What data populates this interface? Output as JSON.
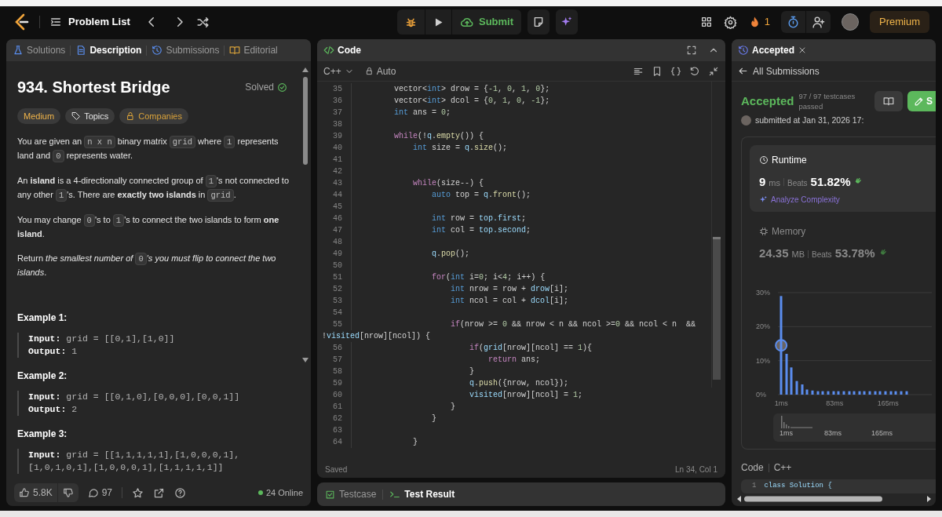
{
  "top_bar": {
    "problem_list": "Problem List",
    "submit": "Submit",
    "streak": "1",
    "premium": "Premium"
  },
  "description_panel": {
    "tabs": [
      {
        "label": "Solutions",
        "selected": false
      },
      {
        "label": "Description",
        "selected": true
      },
      {
        "label": "Submissions",
        "selected": false
      },
      {
        "label": "Editorial",
        "selected": false
      }
    ],
    "title": "934. Shortest Bridge",
    "status": "Solved",
    "tags": [
      {
        "label": "Medium",
        "kind": "difficulty"
      },
      {
        "label": "Topics",
        "kind": "topics"
      },
      {
        "label": "Companies",
        "kind": "locked"
      }
    ],
    "paragraphs": [
      [
        {
          "text": "You are given an "
        },
        {
          "code": "n x n"
        },
        {
          "text": " binary matrix "
        },
        {
          "code": "grid"
        },
        {
          "text": " where "
        },
        {
          "code": "1"
        },
        {
          "text": " represents land and "
        },
        {
          "code": "0"
        },
        {
          "text": " represents water."
        }
      ],
      [
        {
          "text": "An **island** is a 4-directionally connected group of "
        },
        {
          "code": "1"
        },
        {
          "text": "'s not connected to any other "
        },
        {
          "code": "1"
        },
        {
          "text": "'s. There are **exactly two islands** in "
        },
        {
          "code": "grid"
        },
        {
          "text": "."
        }
      ],
      [
        {
          "text": "You may change "
        },
        {
          "code": "0"
        },
        {
          "text": "'s to "
        },
        {
          "code": "1"
        },
        {
          "text": "'s to connect the two islands to form **one island**."
        }
      ],
      [
        {
          "text": "Return *the smallest number of* "
        },
        {
          "code": "0"
        },
        {
          "text": "*'s you must flip to connect the two islands*."
        }
      ]
    ],
    "examples": [
      {
        "title": "Example 1:",
        "input_label": "Input:",
        "input": "grid = [[0,1],[1,0]]",
        "output_label": "Output:",
        "output": "1"
      },
      {
        "title": "Example 2:",
        "input_label": "Input:",
        "input": "grid = [[0,1,0],[0,0,0],[0,0,1]]",
        "output_label": "Output:",
        "output": "2"
      },
      {
        "title": "Example 3:",
        "input_label": "Input:",
        "input": "grid = [[1,1,1,1,1],[1,0,0,0,1],[1,0,1,0,1],[1,0,0,0,1],[1,1,1,1,1]]"
      }
    ],
    "footer": {
      "likes": "5.8K",
      "comments": "97",
      "online": "24 Online"
    }
  },
  "code_panel": {
    "title": "Code",
    "language": "C++",
    "mode": "Auto",
    "lines": [
      {
        "number": "35",
        "tokens": [
          {
            "text": "        vector<",
            "kind": "plain"
          },
          {
            "text": "int",
            "kind": "type"
          },
          {
            "text": "> drow = {",
            "kind": "plain"
          },
          {
            "text": "-1",
            "kind": "number"
          },
          {
            "text": ", ",
            "kind": "plain"
          },
          {
            "text": "0",
            "kind": "number"
          },
          {
            "text": ", ",
            "kind": "plain"
          },
          {
            "text": "1",
            "kind": "number"
          },
          {
            "text": ", ",
            "kind": "plain"
          },
          {
            "text": "0",
            "kind": "number"
          },
          {
            "text": "};",
            "kind": "plain"
          }
        ]
      },
      {
        "number": "36",
        "tokens": [
          {
            "text": "        vector<",
            "kind": "plain"
          },
          {
            "text": "int",
            "kind": "type"
          },
          {
            "text": "> dcol = {",
            "kind": "plain"
          },
          {
            "text": "0",
            "kind": "number"
          },
          {
            "text": ", ",
            "kind": "plain"
          },
          {
            "text": "1",
            "kind": "number"
          },
          {
            "text": ", ",
            "kind": "plain"
          },
          {
            "text": "0",
            "kind": "number"
          },
          {
            "text": ", ",
            "kind": "plain"
          },
          {
            "text": "-1",
            "kind": "number"
          },
          {
            "text": "};",
            "kind": "plain"
          }
        ]
      },
      {
        "number": "37",
        "tokens": [
          {
            "text": "        int",
            "kind": "type"
          },
          {
            "text": " ans = ",
            "kind": "plain"
          },
          {
            "text": "0",
            "kind": "number"
          },
          {
            "text": ";",
            "kind": "plain"
          }
        ]
      },
      {
        "number": "38"
      },
      {
        "number": "39",
        "tokens": [
          {
            "text": "        while",
            "kind": "keyword"
          },
          {
            "text": "(!",
            "kind": "plain"
          },
          {
            "text": "q",
            "kind": "variable"
          },
          {
            "text": ".",
            "kind": "plain"
          },
          {
            "text": "empty",
            "kind": "function"
          },
          {
            "text": "()) {",
            "kind": "plain"
          }
        ]
      },
      {
        "number": "40",
        "tokens": [
          {
            "text": "            int",
            "kind": "type"
          },
          {
            "text": " size = ",
            "kind": "plain"
          },
          {
            "text": "q",
            "kind": "variable"
          },
          {
            "text": ".",
            "kind": "plain"
          },
          {
            "text": "size",
            "kind": "function"
          },
          {
            "text": "();",
            "kind": "plain"
          }
        ]
      },
      {
        "number": "41"
      },
      {
        "number": "42"
      },
      {
        "number": "43",
        "tokens": [
          {
            "text": "            while",
            "kind": "keyword"
          },
          {
            "text": "(size--) {",
            "kind": "plain"
          }
        ]
      },
      {
        "number": "44",
        "tokens": [
          {
            "text": "                auto",
            "kind": "type"
          },
          {
            "text": " top = ",
            "kind": "plain"
          },
          {
            "text": "q",
            "kind": "variable"
          },
          {
            "text": ".",
            "kind": "plain"
          },
          {
            "text": "front",
            "kind": "function"
          },
          {
            "text": "();",
            "kind": "plain"
          }
        ]
      },
      {
        "number": "45"
      },
      {
        "number": "46",
        "tokens": [
          {
            "text": "                int",
            "kind": "type"
          },
          {
            "text": " row = ",
            "kind": "plain"
          },
          {
            "text": "top.first",
            "kind": "variable"
          },
          {
            "text": ";",
            "kind": "plain"
          }
        ]
      },
      {
        "number": "47",
        "tokens": [
          {
            "text": "                int",
            "kind": "type"
          },
          {
            "text": " col = ",
            "kind": "plain"
          },
          {
            "text": "top.second",
            "kind": "variable"
          },
          {
            "text": ";",
            "kind": "plain"
          }
        ]
      },
      {
        "number": "48"
      },
      {
        "number": "49",
        "tokens": [
          {
            "text": "                q",
            "kind": "variable"
          },
          {
            "text": ".",
            "kind": "plain"
          },
          {
            "text": "pop",
            "kind": "function"
          },
          {
            "text": "();",
            "kind": "plain"
          }
        ]
      },
      {
        "number": "50"
      },
      {
        "number": "51",
        "tokens": [
          {
            "text": "                for",
            "kind": "keyword"
          },
          {
            "text": "(",
            "kind": "plain"
          },
          {
            "text": "int",
            "kind": "type"
          },
          {
            "text": " i=",
            "kind": "plain"
          },
          {
            "text": "0",
            "kind": "number"
          },
          {
            "text": "; i<",
            "kind": "plain"
          },
          {
            "text": "4",
            "kind": "number"
          },
          {
            "text": "; i++) {",
            "kind": "plain"
          }
        ]
      },
      {
        "number": "52",
        "tokens": [
          {
            "text": "                    int",
            "kind": "type"
          },
          {
            "text": " nrow = row + ",
            "kind": "plain"
          },
          {
            "text": "drow",
            "kind": "variable"
          },
          {
            "text": "[i];",
            "kind": "plain"
          }
        ]
      },
      {
        "number": "53",
        "tokens": [
          {
            "text": "                    int",
            "kind": "type"
          },
          {
            "text": " ncol = col + ",
            "kind": "plain"
          },
          {
            "text": "dcol",
            "kind": "variable"
          },
          {
            "text": "[i];",
            "kind": "plain"
          }
        ]
      },
      {
        "number": "54"
      },
      {
        "number": "55",
        "tokens": [
          {
            "text": "                    if",
            "kind": "keyword"
          },
          {
            "text": "(nrow >= ",
            "kind": "plain"
          },
          {
            "text": "0",
            "kind": "number"
          },
          {
            "text": " && nrow < n && ncol >=",
            "kind": "plain"
          },
          {
            "text": "0",
            "kind": "number"
          },
          {
            "text": " && ncol < n  &&",
            "kind": "plain"
          }
        ]
      },
      {
        "tokens": [
          {
            "text": "!",
            "kind": "plain"
          },
          {
            "text": "visited",
            "kind": "variable"
          },
          {
            "text": "[nrow][ncol]) {",
            "kind": "plain"
          }
        ]
      },
      {
        "number": "56",
        "tokens": [
          {
            "text": "                        if",
            "kind": "keyword"
          },
          {
            "text": "(",
            "kind": "plain"
          },
          {
            "text": "grid",
            "kind": "variable"
          },
          {
            "text": "[nrow][ncol] == ",
            "kind": "plain"
          },
          {
            "text": "1",
            "kind": "number"
          },
          {
            "text": "){",
            "kind": "plain"
          }
        ]
      },
      {
        "number": "57",
        "tokens": [
          {
            "text": "                            return",
            "kind": "keyword"
          },
          {
            "text": " ans;",
            "kind": "plain"
          }
        ]
      },
      {
        "number": "58",
        "tokens": [
          {
            "text": "                        }",
            "kind": "plain"
          }
        ]
      },
      {
        "number": "59",
        "tokens": [
          {
            "text": "                        q",
            "kind": "variable"
          },
          {
            "text": ".",
            "kind": "plain"
          },
          {
            "text": "push",
            "kind": "function"
          },
          {
            "text": "({nrow, ncol});",
            "kind": "plain"
          }
        ]
      },
      {
        "number": "60",
        "tokens": [
          {
            "text": "                        visited",
            "kind": "variable"
          },
          {
            "text": "[nrow][ncol] = ",
            "kind": "plain"
          },
          {
            "text": "1",
            "kind": "number"
          },
          {
            "text": ";",
            "kind": "plain"
          }
        ]
      },
      {
        "number": "61",
        "tokens": [
          {
            "text": "                    }",
            "kind": "plain"
          }
        ]
      },
      {
        "number": "62",
        "tokens": [
          {
            "text": "                }",
            "kind": "plain"
          }
        ]
      },
      {
        "number": "63"
      },
      {
        "number": "64",
        "tokens": [
          {
            "text": "            }",
            "kind": "plain"
          }
        ]
      }
    ],
    "save_status": "Saved",
    "cursor": "Ln 34, Col 1",
    "bottom_tabs": [
      {
        "label": "Testcase",
        "selected": false
      },
      {
        "label": "Test Result",
        "selected": true
      }
    ]
  },
  "result_panel": {
    "tab": "Accepted",
    "back": "All Submissions",
    "verdict": "Accepted",
    "testcases": "97 / 97 testcases passed",
    "solution_button": "S",
    "submitted": "submitted at Jan 31, 2026 17:",
    "metrics": [
      {
        "label": "Runtime",
        "value": "9",
        "unit": "ms",
        "beats_label": "Beats",
        "beats": "51.82%",
        "action": "Analyze Complexity",
        "selected": true
      },
      {
        "label": "Memory",
        "value": "24.35",
        "unit": "MB",
        "beats_label": "Beats",
        "beats": "53.78%",
        "selected": false
      }
    ],
    "chart_data": {
      "type": "bar",
      "x": [
        1,
        9,
        17,
        25,
        33,
        41,
        49,
        57,
        65,
        73,
        81,
        89,
        97,
        105,
        113,
        121,
        129,
        137,
        145,
        153,
        161,
        169,
        177,
        185,
        193
      ],
      "values": [
        29,
        12,
        8,
        4,
        3,
        1.5,
        1.2,
        1,
        1,
        1,
        1,
        1,
        1,
        1,
        1,
        1,
        1,
        1,
        1,
        1,
        1,
        1,
        1,
        1,
        1
      ],
      "xlim": [
        -4,
        232
      ],
      "xticks": [
        {
          "value": 1,
          "label": "1ms"
        },
        {
          "value": 83,
          "label": "83ms"
        },
        {
          "value": 165,
          "label": "165ms"
        }
      ],
      "yticks": [
        {
          "value": 0,
          "label": "0%"
        },
        {
          "value": 10,
          "label": "10%"
        },
        {
          "value": 20,
          "label": "20%"
        },
        {
          "value": 30,
          "label": "30%"
        }
      ],
      "ylim": [
        0,
        30
      ]
    },
    "overview_labels": [
      "1ms",
      "83ms",
      "165ms"
    ],
    "code_label": "Code",
    "code_language": "C++",
    "code_preview": {
      "number": "1",
      "text": "class Solution {"
    }
  }
}
